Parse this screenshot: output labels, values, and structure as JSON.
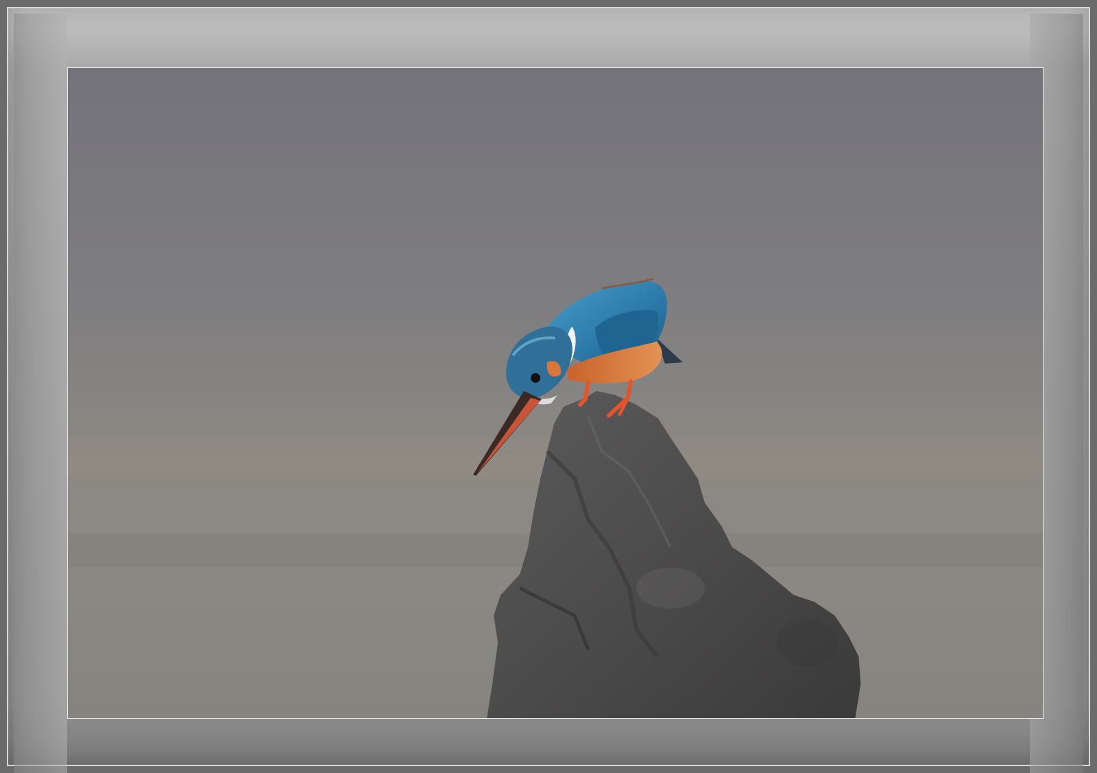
{
  "image": {
    "subject": "kingfisher-on-rock",
    "colors": {
      "frame": "#9a9a9a",
      "background_top": "#74737a",
      "background_bottom": "#8d8a84",
      "rock": "#4f4e4e",
      "bird_back": "#2f7fb3",
      "bird_breast": "#d9773a",
      "beak": "#3a2a26",
      "feet": "#e4552b"
    }
  }
}
